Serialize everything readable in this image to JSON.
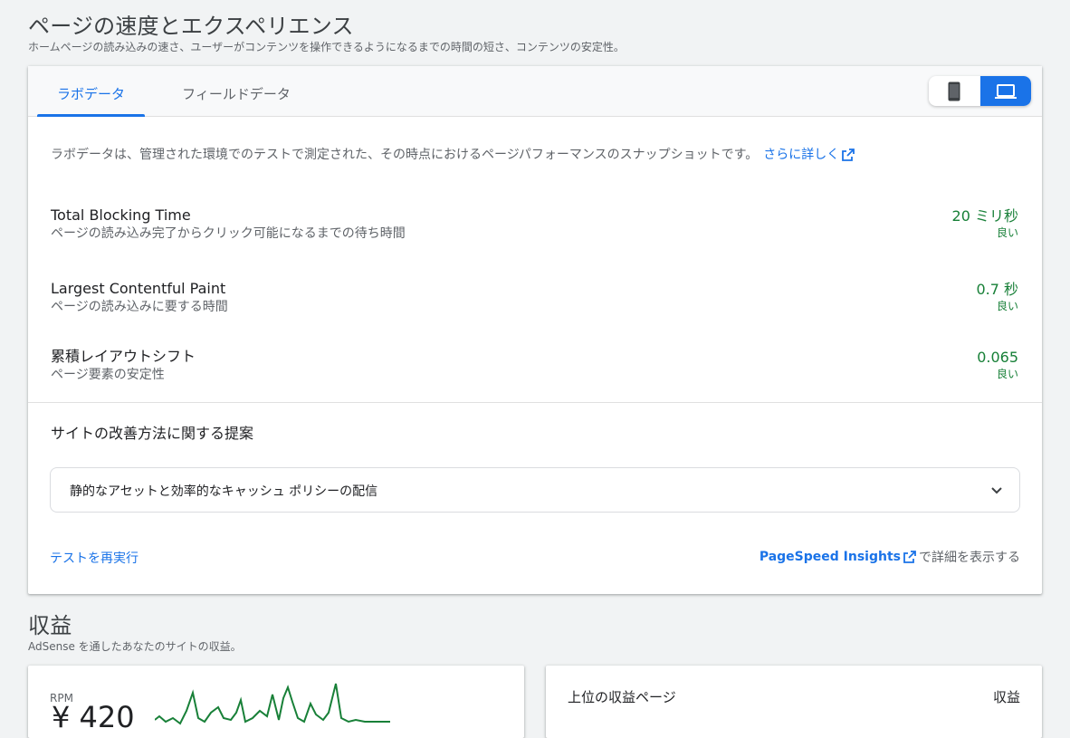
{
  "speed_section": {
    "title": "ページの速度とエクスペリエンス",
    "subtitle": "ホームページの読み込みの速さ、ユーザーがコンテンツを操作できるようになるまでの時間の短さ、コンテンツの安定性。"
  },
  "tabs": [
    {
      "label": "ラボデータ",
      "active": true
    },
    {
      "label": "フィールドデータ",
      "active": false
    }
  ],
  "device_toggle": {
    "mobile_icon": "smartphone-icon",
    "desktop_icon": "laptop-icon",
    "selected": "desktop"
  },
  "lab_description": {
    "text": "ラボデータは、管理された環境でのテストで測定された、その時点におけるページパフォーマンスのスナップショットです。",
    "learn_more": "さらに詳しく"
  },
  "metrics": [
    {
      "name": "Total Blocking Time",
      "desc": "ページの読み込み完了からクリック可能になるまでの待ち時間",
      "value": "20 ミリ秒",
      "rating": "良い"
    },
    {
      "name": "Largest Contentful Paint",
      "desc": "ページの読み込みに要する時間",
      "value": "0.7 秒",
      "rating": "良い"
    },
    {
      "name": "累積レイアウトシフト",
      "desc": "ページ要素の安定性",
      "value": "0.065",
      "rating": "良い"
    }
  ],
  "suggestions": {
    "title": "サイトの改善方法に関する提案",
    "items": [
      "静的なアセットと効率的なキャッシュ ポリシーの配信"
    ]
  },
  "footer": {
    "rerun": "テストを再実行",
    "psi_link": "PageSpeed Insights",
    "psi_suffix": "で詳細を表示する"
  },
  "revenue_section": {
    "title": "収益",
    "subtitle": "AdSense を通したあなたのサイトの収益。"
  },
  "rpm_card": {
    "label": "RPM",
    "value": "¥ 420"
  },
  "top_pages_card": {
    "label": "上位の収益ページ",
    "column": "収益"
  },
  "colors": {
    "accent": "#1a73e8",
    "good": "#188038",
    "sparkline": "#188038"
  }
}
